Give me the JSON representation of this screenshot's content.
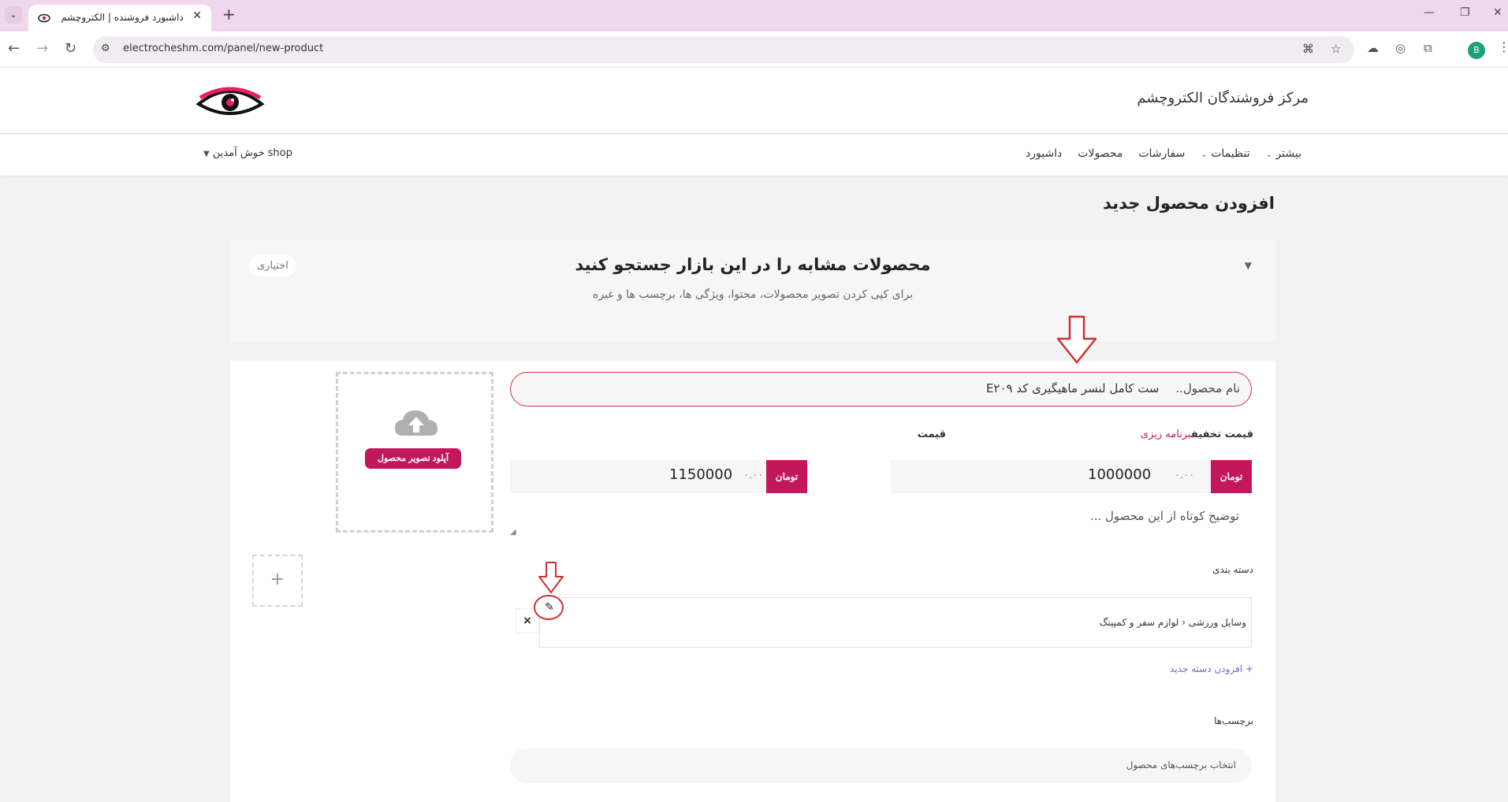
{
  "browser": {
    "tab_title": "داشبورد فروشنده | الکتروچشم",
    "url": "electrocheshm.com/panel/new-product",
    "profile_initial": "B",
    "icons": [
      "tab-list-icon",
      "favicon-eye-icon",
      "close-tab-icon",
      "new-tab-icon",
      "minimize-icon",
      "restore-icon",
      "close-window-icon",
      "back-icon",
      "forward-icon",
      "reload-icon",
      "site-info-icon",
      "translate-icon",
      "bookmark-star-icon",
      "extensions-icon",
      "kebab-menu-icon"
    ]
  },
  "header": {
    "site_name": "مرکز فروشندگان الکتروچشم"
  },
  "nav": {
    "items": [
      "داشبورد",
      "محصولات",
      "سفارشات",
      "تنظیمات",
      "بیشتر"
    ],
    "welcome": "shop خوش آمدین"
  },
  "page": {
    "title": "افزودن محصول جدید"
  },
  "search_card": {
    "heading": "محصولات مشابه را در این بازار جستجو کنید",
    "subtitle": "برای کپی کردن تصویر محصولات، محتوا، ویژگی ها، برچسب ها و غیره",
    "optional": "اختیاری"
  },
  "form": {
    "upload_label": "آپلود تصویر محصول",
    "add_image": "+",
    "name_placeholder": "نام محصول..",
    "name_value": "ست کامل لنسر ماهیگیری کد E۲۰۹",
    "price_label": "قیمت",
    "schedule_link": "برنامه ریزی",
    "sale_price_label": "قیمت تخفیف",
    "currency": "تومان",
    "decimal": "۰.۰۰",
    "price_value": "1150000",
    "sale_price_value": "1000000",
    "short_desc_placeholder": "توضیح کوتاه از این محصول ...",
    "category_label": "دسته بندی",
    "category_parent": "وسایل ورزشی",
    "category_separator": "‹",
    "category_child": "لوازم سفر و کمپینگ",
    "remove_symbol": "×",
    "add_category": "+ افزودن دسته جدید",
    "tags_label": "برچسب‌ها",
    "tags_placeholder": "انتخاب برچسب‌های محصول"
  },
  "colors": {
    "accent": "#c2185b",
    "annotation_red": "#d32f2f",
    "tabbar": "#efd8ec"
  }
}
